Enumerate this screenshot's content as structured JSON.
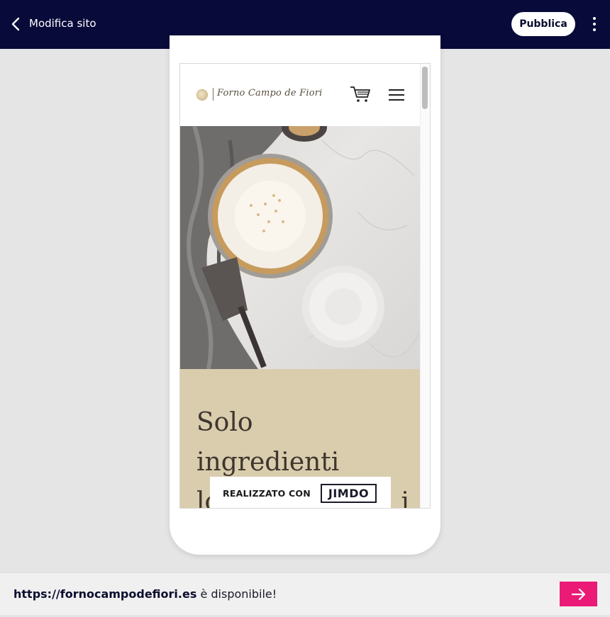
{
  "topbar": {
    "back_icon": "chevron-left-icon",
    "title": "Modifica sito",
    "publish_label": "Pubblica",
    "more_icon": "more-vertical-icon"
  },
  "preview": {
    "site_name": "Forno Campo de Fiori",
    "logo_icon": "logo-icon",
    "cart_icon": "cart-icon",
    "menu_icon": "hamburger-menu-icon",
    "hero_alt": "hero-pie-image",
    "headline_line1": "Solo",
    "headline_line2": "ingredienti",
    "headline_line3": "lo",
    "headline_tail": "i",
    "badge_text": "REALIZZATO CON",
    "badge_brand": "JIMDO"
  },
  "bottom": {
    "domain": "https://fornocampodefiori.es",
    "message": " è disponibile!",
    "arrow_icon": "arrow-right-icon"
  },
  "colors": {
    "topbar_bg": "#080a3a",
    "accent": "#ea1a76",
    "text_block_bg": "#d9cdae"
  }
}
